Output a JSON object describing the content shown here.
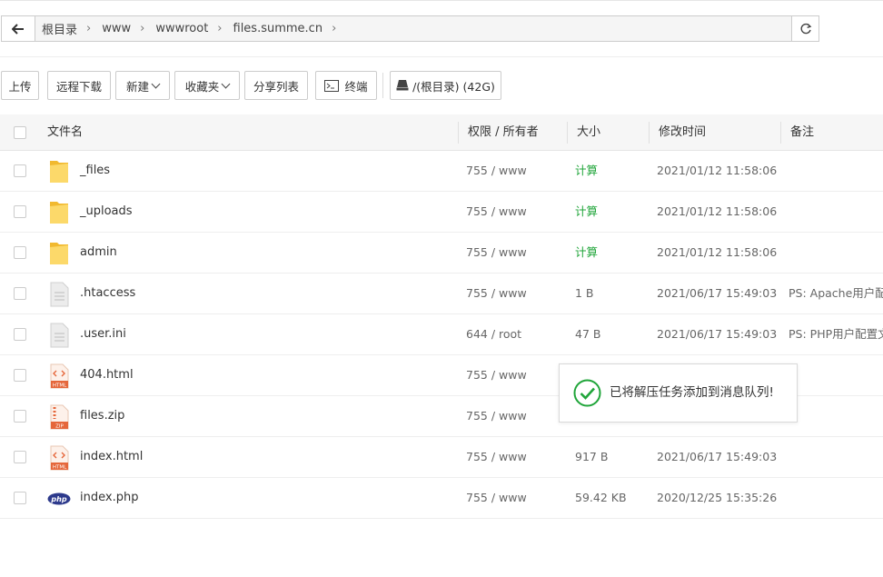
{
  "breadcrumb": {
    "items": [
      "根目录",
      "www",
      "wwwroot",
      "files.summe.cn"
    ]
  },
  "toolbar": {
    "upload": "上传",
    "remote_download": "远程下载",
    "new": "新建",
    "favorites": "收藏夹",
    "share_list": "分享列表",
    "terminal": "终端",
    "disk": "/(根目录) (42G)"
  },
  "table": {
    "headers": {
      "name": "文件名",
      "perm": "权限 / 所有者",
      "size": "大小",
      "mtime": "修改时间",
      "note": "备注"
    },
    "rows": [
      {
        "icon": "folder-icon",
        "name": "_files",
        "perm": "755 / www",
        "size": "计算",
        "mtime": "2021/01/12 11:58:06",
        "note": ""
      },
      {
        "icon": "folder-icon",
        "name": "_uploads",
        "perm": "755 / www",
        "size": "计算",
        "mtime": "2021/01/12 11:58:06",
        "note": ""
      },
      {
        "icon": "folder-icon",
        "name": "admin",
        "perm": "755 / www",
        "size": "计算",
        "mtime": "2021/01/12 11:58:06",
        "note": ""
      },
      {
        "icon": "text-file-icon",
        "name": ".htaccess",
        "perm": "755 / www",
        "size": "1 B",
        "mtime": "2021/06/17 15:49:03",
        "note": "PS: Apache用户配置"
      },
      {
        "icon": "text-file-icon",
        "name": ".user.ini",
        "perm": "644 / root",
        "size": "47 B",
        "mtime": "2021/06/17 15:49:03",
        "note": "PS: PHP用户配置文"
      },
      {
        "icon": "html-file-icon",
        "name": "404.html",
        "perm": "755 / www",
        "size": "",
        "mtime": "",
        "note": ""
      },
      {
        "icon": "zip-file-icon",
        "name": "files.zip",
        "perm": "755 / www",
        "size": "",
        "mtime": "",
        "note": ""
      },
      {
        "icon": "html-file-icon",
        "name": "index.html",
        "perm": "755 / www",
        "size": "917 B",
        "mtime": "2021/06/17 15:49:03",
        "note": ""
      },
      {
        "icon": "php-file-icon",
        "name": "index.php",
        "perm": "755 / www",
        "size": "59.42 KB",
        "mtime": "2020/12/25 15:35:26",
        "note": ""
      }
    ]
  },
  "toast": {
    "message": "已将解压任务添加到消息队列!"
  },
  "icon_labels": {
    "html": "HTML",
    "zip": "ZIP",
    "php": "php"
  },
  "colors": {
    "calc_green": "#20a53a",
    "success_green": "#20a53a",
    "folder_yellow": "#f5c843"
  }
}
